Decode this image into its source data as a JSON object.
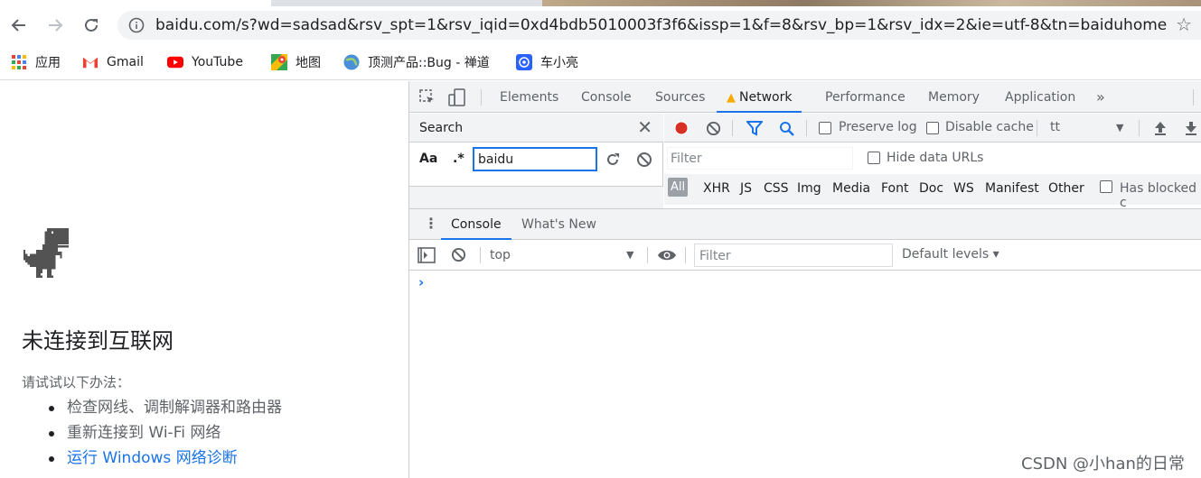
{
  "browser": {
    "url": "baidu.com/s?wd=sadsad&rsv_spt=1&rsv_iqid=0xd4bdb5010003f3f6&issp=1&f=8&rsv_bp=1&rsv_idx=2&ie=utf-8&tn=baiduhome..."
  },
  "bookmarks": [
    {
      "label": "应用",
      "icon": "apps-grid-icon"
    },
    {
      "label": "Gmail",
      "icon": "gmail-icon"
    },
    {
      "label": "YouTube",
      "icon": "youtube-icon"
    },
    {
      "label": "地图",
      "icon": "maps-icon"
    },
    {
      "label": "顶测产品::Bug - 禅道",
      "icon": "globe-icon"
    },
    {
      "label": "车小亮",
      "icon": "app-icon"
    }
  ],
  "offline": {
    "title": "未连接到互联网",
    "subtitle": "请试试以下办法：",
    "items": [
      "检查网线、调制解调器和路由器",
      "重新连接到 Wi-Fi 网络",
      "运行 Windows 网络诊断"
    ]
  },
  "devtools": {
    "tabs": [
      "Elements",
      "Console",
      "Sources",
      "Network",
      "Performance",
      "Memory",
      "Application"
    ],
    "more": "»",
    "search": {
      "label": "Search",
      "case_toggle": "Aa",
      "regex_toggle": ".*",
      "query": "baidu"
    },
    "network": {
      "preserve_log": "Preserve log",
      "disable_cache": "Disable cache",
      "throttle": "tt",
      "filter_placeholder": "Filter",
      "hide_data_urls": "Hide data URLs",
      "types": [
        "All",
        "XHR",
        "JS",
        "CSS",
        "Img",
        "Media",
        "Font",
        "Doc",
        "WS",
        "Manifest",
        "Other"
      ],
      "has_blocked": "Has blocked c"
    },
    "drawer": {
      "tabs": [
        "Console",
        "What's New"
      ],
      "context": "top",
      "filter_placeholder": "Filter",
      "levels": "Default levels ▾",
      "prompt": "›"
    }
  },
  "watermark": "CSDN @小han的日常"
}
